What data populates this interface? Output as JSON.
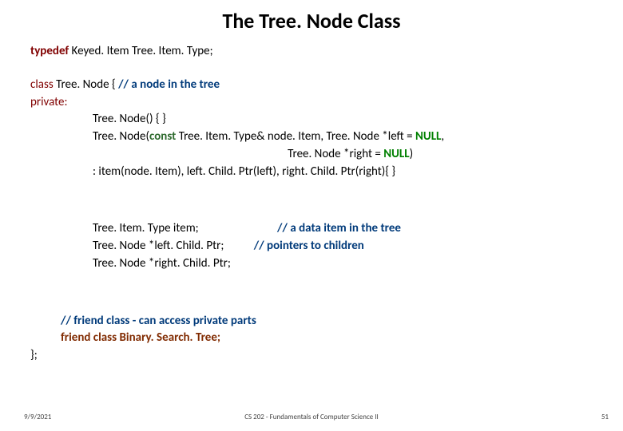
{
  "title": "The Tree. Node Class",
  "code": {
    "l1_typedef": "typedef",
    "l1_rest": " Keyed. Item Tree. Item. Type;",
    "l3a_class": "class ",
    "l3a_name": "Tree. Node {      ",
    "l3a_cmt": "// a node in the tree",
    "l3b_private": "private:",
    "c1": "Tree. Node() { }",
    "c2a": "Tree. Node(",
    "c2b_const": "const",
    "c2c": " Tree. Item. Type& node. Item, Tree. Node *left = ",
    "c2d_null": "NULL",
    "c2e": ",",
    "c3a_pad": "                                                                        Tree. Node *right = ",
    "c3b_null": "NULL",
    "c3c": ")",
    "c4": ": item(node. Item), left. Child. Ptr(left), right. Child. Ptr(right){ }",
    "m1a": "Tree. Item. Type item;",
    "m1pad": "                             ",
    "m1b_cmt": "// a data item in the tree",
    "m2a": "Tree. Node *left. Child. Ptr;",
    "m2pad": "           ",
    "m2b_cmt": "// pointers to children",
    "m3": "Tree. Node *right. Child. Ptr;",
    "fcmt": "// friend class - can access private parts",
    "fline": "friend class Binary. Search. Tree;",
    "endbrace": "};"
  },
  "footer": {
    "date": "9/9/2021",
    "center": "CS 202 - Fundamentals of Computer Science II",
    "page": "51"
  }
}
